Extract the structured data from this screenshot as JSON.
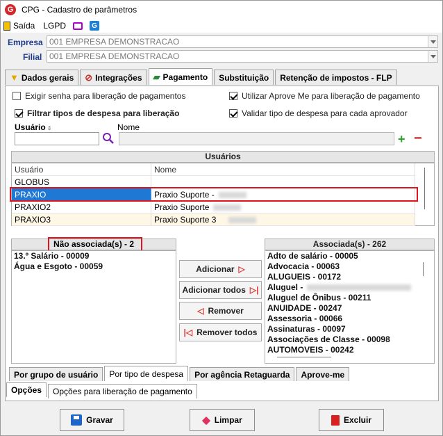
{
  "window": {
    "title": "CPG - Cadastro de parâmetros"
  },
  "menu": {
    "saida": "Saída",
    "lgpd": "LGPD"
  },
  "empresa": {
    "label": "Empresa",
    "value": "001 EMPRESA DEMONSTRACAO"
  },
  "filial": {
    "label": "Filial",
    "value": "001 EMPRESA DEMONSTRACAO"
  },
  "tabs": [
    {
      "label": "Dados gerais"
    },
    {
      "label": "Integrações"
    },
    {
      "label": "Pagamento"
    },
    {
      "label": "Substituição"
    },
    {
      "label": "Retenção de impostos - FLP"
    }
  ],
  "options": {
    "exigir_senha": "Exigir senha para liberação de pagamentos",
    "utilizar_aprove": "Utilizar Aprove Me para liberação de pagamento",
    "filtrar_tipos": "Filtrar tipos de despesa para liberação",
    "validar_tipo": "Validar tipo de despesa para cada aprovador"
  },
  "search": {
    "usuario_label": "Usuário",
    "nome_label": "Nome"
  },
  "usuarios": {
    "title": "Usuários",
    "columns": [
      "Usuário",
      "Nome"
    ],
    "rows": [
      {
        "usuario": "GLOBUS",
        "nome": ""
      },
      {
        "usuario": "PRAXIO",
        "nome": "Praxio Suporte -"
      },
      {
        "usuario": "PRAXIO2",
        "nome": "Praxio Suporte"
      },
      {
        "usuario": "PRAXIO3",
        "nome": "Praxio Suporte 3"
      }
    ]
  },
  "nao_associadas": {
    "title": "Não associada(s) - 2",
    "items": [
      "13.º Salário - 00009",
      "Água e Esgoto - 00059"
    ]
  },
  "associadas": {
    "title": "Associada(s) - 262",
    "items": [
      "Adto de salário - 00005",
      "Advocacia - 00063",
      "ALUGUEIS - 00172",
      "Aluguel -",
      "Aluguel de Ônibus - 00211",
      "ANUIDADE - 00247",
      "Assessoria - 00066",
      "Assinaturas - 00097",
      "Associações de Classe - 00098",
      "AUTOMOVEIS - 00242"
    ]
  },
  "actions": {
    "adicionar": "Adicionar",
    "adicionar_todos": "Adicionar todos",
    "remover": "Remover",
    "remover_todos": "Remover todos"
  },
  "subtabs": [
    "Por grupo de usuário",
    "Por tipo de despesa",
    "Por agência Retaguarda",
    "Aprove-me"
  ],
  "bottom_tabs": [
    "Opções",
    "Opções para liberação de pagamento"
  ],
  "footer": {
    "gravar": "Gravar",
    "limpar": "Limpar",
    "excluir": "Excluir"
  }
}
